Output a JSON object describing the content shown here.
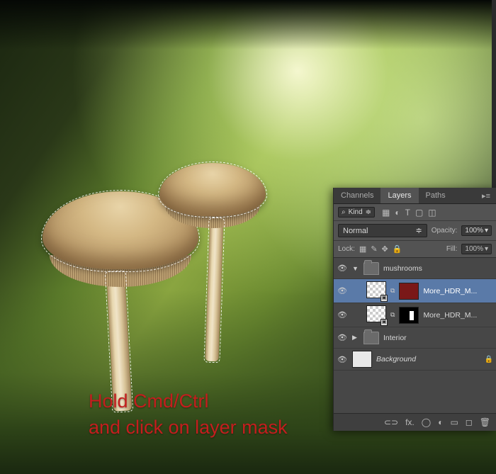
{
  "annotation": {
    "line1": "Hold Cmd/Ctrl",
    "line2": "and click on layer mask"
  },
  "panel": {
    "tabs": {
      "channels": "Channels",
      "layers": "Layers",
      "paths": "Paths"
    },
    "filter": {
      "kind_label": "Kind",
      "divider": "≑"
    },
    "blend": {
      "mode": "Normal",
      "opacity_label": "Opacity:",
      "opacity_value": "100%"
    },
    "lock": {
      "label": "Lock:",
      "fill_label": "Fill:",
      "fill_value": "100%"
    },
    "layers": {
      "group_name": "mushrooms",
      "hdr1": "More_HDR_M...",
      "hdr2": "More_HDR_M...",
      "interior": "Interior",
      "background": "Background"
    },
    "footer": {
      "link": "⊂⊃",
      "fx": "fx.",
      "mask": "◯",
      "adjust": "◐",
      "folder": "▭",
      "new": "◻",
      "trash": "🗑"
    }
  }
}
